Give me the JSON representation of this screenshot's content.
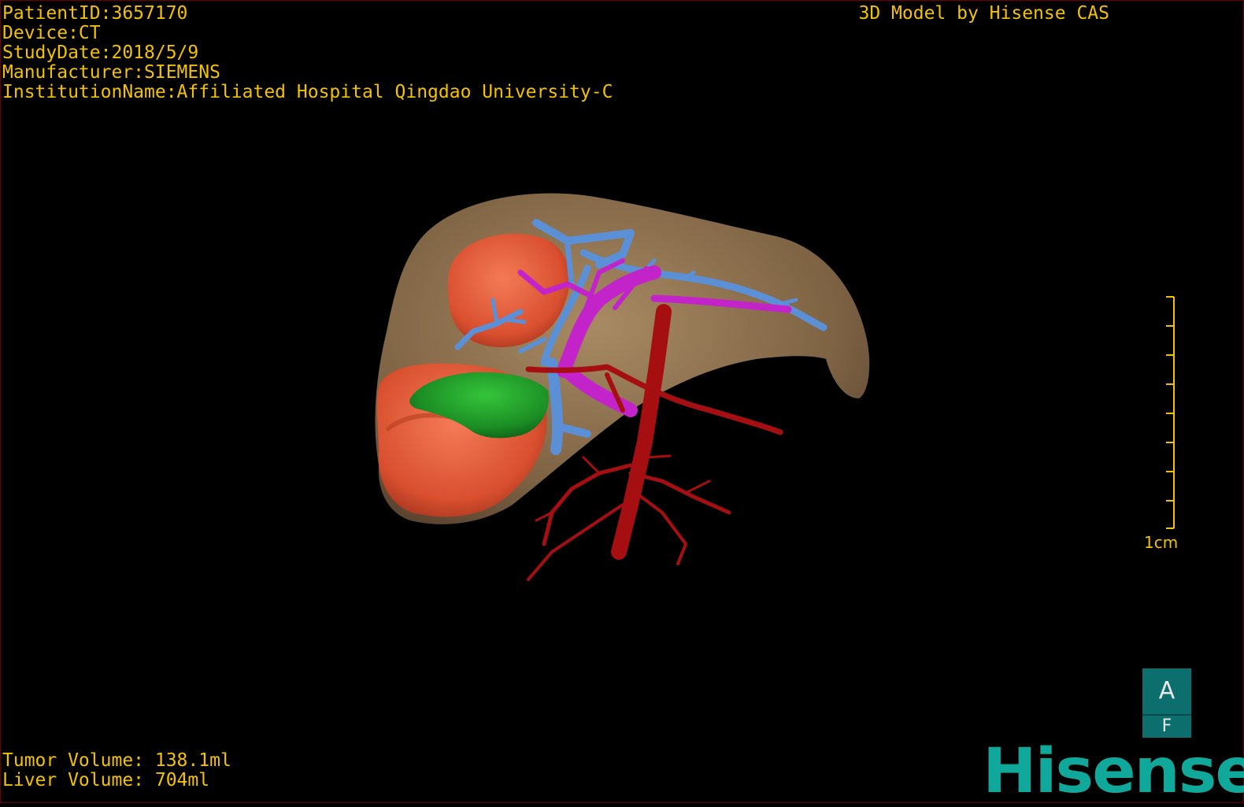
{
  "viewer": {
    "patient_line": "PatientID:3657170",
    "device_line": "Device:CT",
    "study_date_line": "StudyDate:2018/5/9",
    "manufacturer_line": "Manufacturer:SIEMENS",
    "institution_line": "InstitutionName:Affiliated Hospital Qingdao University-C",
    "model_credit": "3D Model by Hisense CAS",
    "tumor_volume_line": "Tumor Volume: 138.1ml",
    "liver_volume_line": "Liver Volume: 704ml",
    "scale_label": "1cm",
    "orientation_top": "A",
    "orientation_bottom": "F",
    "logo_text": "Hisense"
  },
  "colors": {
    "overlay_text": "#f2c200",
    "liver": "#8b6f4e",
    "tumor": "#e0583a",
    "gallbladder": "#1f8a2a",
    "portal_vein": "#c324c9",
    "hepatic_vein": "#5b8fd6",
    "artery": "#a50f12",
    "orientation_box": "#0d6f6d",
    "logo": "#10a89a"
  }
}
